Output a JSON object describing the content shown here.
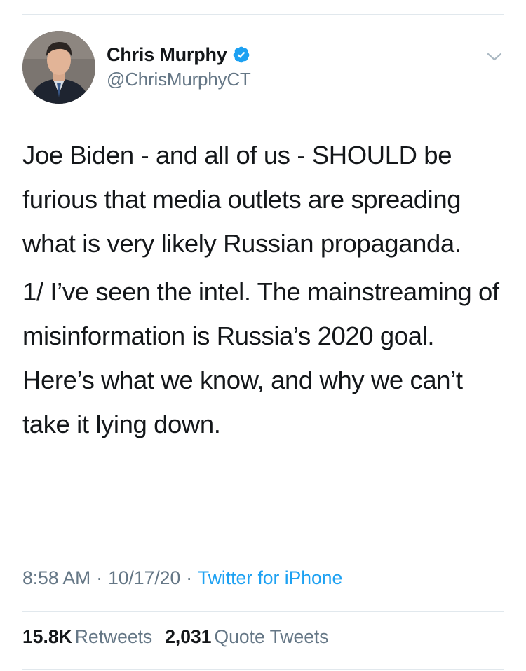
{
  "author": {
    "display_name": "Chris Murphy",
    "handle": "@ChrisMurphyCT",
    "verified": true,
    "avatar_icon": "profile-photo"
  },
  "tweet": {
    "paragraphs": [
      "Joe Biden - and all of us - SHOULD be furious that media outlets are spreading what is very likely Russian propaganda.",
      "1/ I’ve seen the intel. The mainstreaming of misinformation is Russia’s 2020 goal. Here’s what we know, and why we can’t take it lying down."
    ]
  },
  "meta": {
    "time": "8:58 AM",
    "separator": "·",
    "date": "10/17/20",
    "source": "Twitter for iPhone"
  },
  "stats": {
    "retweets_count": "15.8K",
    "retweets_label": "Retweets",
    "quotes_count": "2,031",
    "quotes_label": "Quote Tweets"
  },
  "colors": {
    "text_primary": "#14171a",
    "text_secondary": "#657786",
    "accent": "#1da1f2",
    "divider": "#e1e8ed"
  },
  "icons": {
    "verified": "verified-badge-icon",
    "menu": "chevron-down-icon"
  }
}
